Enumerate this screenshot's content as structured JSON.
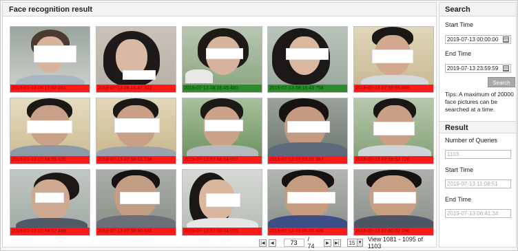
{
  "left_panel": {
    "title": "Face recognition result"
  },
  "results": [
    {
      "stamp": "2019-07-13 08:17:02 093",
      "status": "red"
    },
    {
      "stamp": "2019-07-13 08:16:47 322",
      "status": "red"
    },
    {
      "stamp": "2019-07-13 08:16:45 480",
      "status": "green"
    },
    {
      "stamp": "2019-07-13 08:16:43 758",
      "status": "green"
    },
    {
      "stamp": "2019-07-13 07:59:55 898",
      "status": "red"
    },
    {
      "stamp": "2019-07-13 07:58:55 525",
      "status": "red"
    },
    {
      "stamp": "2019-07-13 07:58:53 198",
      "status": "red"
    },
    {
      "stamp": "2019-07-13 07:58:54 007",
      "status": "red"
    },
    {
      "stamp": "2019-07-13 07:58:53 387",
      "status": "red"
    },
    {
      "stamp": "2019-07-13 07:58:52 726",
      "status": "red"
    },
    {
      "stamp": "2019-07-13 07:58:52 488",
      "status": "red"
    },
    {
      "stamp": "2019-07-13 07:58:50 685",
      "status": "red"
    },
    {
      "stamp": "2019-07-13 07:00:04 015",
      "status": "red"
    },
    {
      "stamp": "2019-07-13 07:00:02 326",
      "status": "red"
    },
    {
      "stamp": "2019-07-13 07:00:02 296",
      "status": "red"
    }
  ],
  "pager": {
    "first_icon": "first-page-icon",
    "prev_icon": "prev-page-icon",
    "next_icon": "next-page-icon",
    "last_icon": "last-page-icon",
    "current_page": "73",
    "total_pages": "/ 74",
    "page_size": "15",
    "view_text": "View 1081 - 1095 of 1103"
  },
  "search": {
    "title": "Search",
    "start_label": "Start Time",
    "start_value": "2019-07-13 00:00:00",
    "end_label": "End Time",
    "end_value": "2019-07-13 23:59:59",
    "button_label": "Search",
    "tips": "Tips: A maximum of 20000 face pictures can be searched at a time."
  },
  "result_summary": {
    "title": "Result",
    "queries_label": "Number of Queries",
    "queries_value": "1103",
    "start_label": "Start Time",
    "start_value": "2019-07-13  11:08:51",
    "end_label": "End Time",
    "end_value": "2019-07-13  06:41:34"
  },
  "colors": {
    "stamp_red": "#ff1a1a",
    "stamp_green": "#2e8b2e"
  }
}
